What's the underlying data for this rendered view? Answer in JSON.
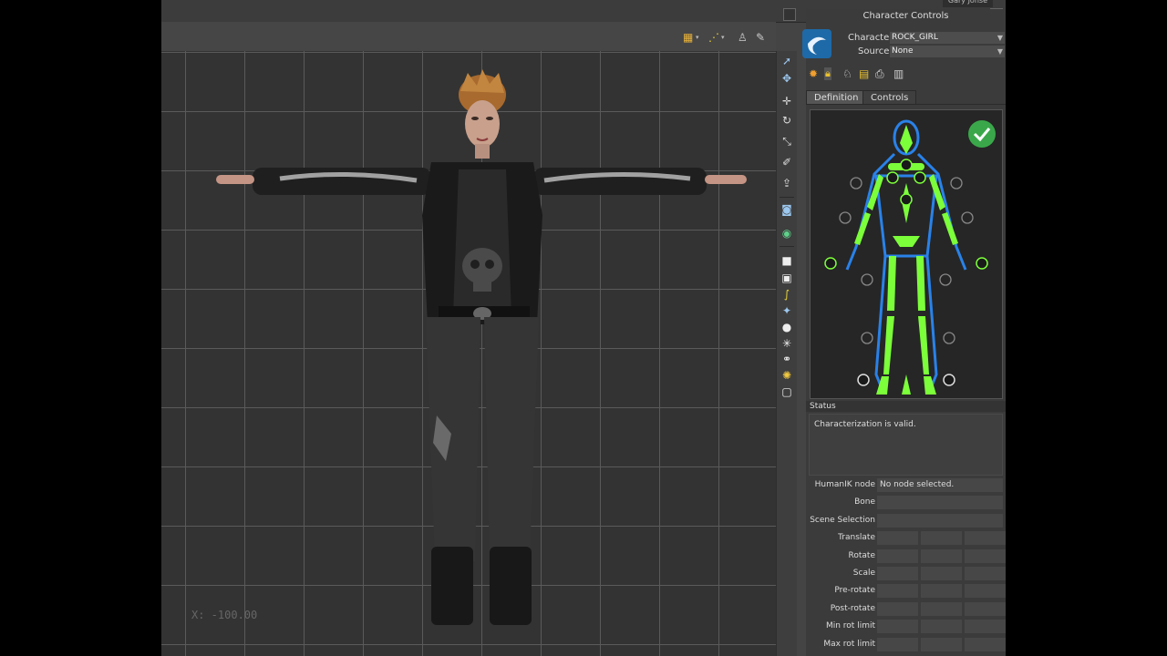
{
  "window": {
    "user_label": "Gary Jonse"
  },
  "viewport": {
    "coordinate_readout": "X: -100.00"
  },
  "panel": {
    "title": "Character Controls",
    "character_label": "Character:",
    "character_value": "ROCK_GIRL",
    "source_label": "Source:",
    "source_value": "None",
    "tabs": [
      {
        "label": "Definition",
        "active": true
      },
      {
        "label": "Controls",
        "active": false
      }
    ],
    "status_header": "Status",
    "status_text": "Characterization is valid.",
    "properties": [
      {
        "label": "HumanIK node",
        "value": "No node selected."
      },
      {
        "label": "Bone",
        "value": ""
      },
      {
        "label": "Scene Selection",
        "value": ""
      },
      {
        "label": "Translate",
        "triple": true
      },
      {
        "label": "Rotate",
        "triple": true
      },
      {
        "label": "Scale",
        "triple": true
      },
      {
        "label": "Pre-rotate",
        "triple": true
      },
      {
        "label": "Post-rotate",
        "triple": true
      },
      {
        "label": "Min rot limit",
        "triple": true
      },
      {
        "label": "Max rot limit",
        "triple": true
      }
    ]
  },
  "icons": {
    "toolbar": [
      "calendar-icon",
      "curve-icon",
      "person-2d-icon",
      "brush-icon"
    ],
    "toolstrip": [
      "select-arrow-icon",
      "move-icon",
      "rotate-icon",
      "scale-icon",
      "paint-icon",
      "export-icon",
      "camera-icon",
      "globe-icon",
      "cube-icon",
      "sphere-icon",
      "curve-tool-icon",
      "light-icon",
      "star-icon",
      "frame-icon"
    ],
    "panel_toolbar": [
      "star-icon",
      "lock-icon",
      "figure-icon",
      "folder-icon",
      "save-icon",
      "delete-icon"
    ]
  },
  "colors": {
    "accent_green": "#7cff3a",
    "valid_check": "#3aa84a",
    "skeleton_blue": "#2a8cff"
  }
}
